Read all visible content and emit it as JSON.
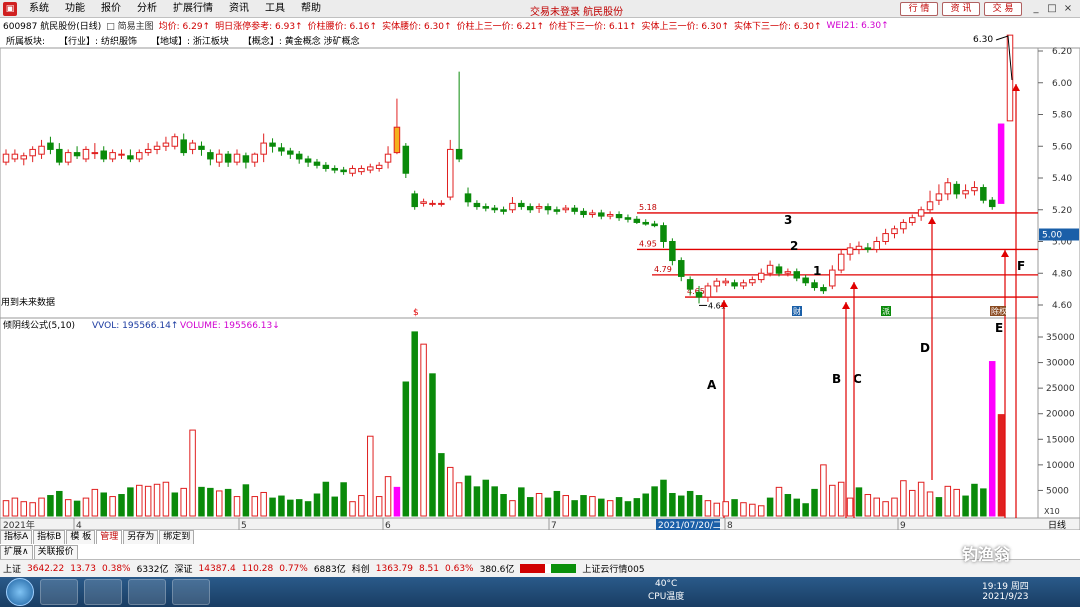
{
  "menu": {
    "items": [
      "系统",
      "功能",
      "报价",
      "分析",
      "扩展行情",
      "资讯",
      "工具",
      "帮助"
    ],
    "center_text": "交易未登录 航民股份",
    "right_buttons": [
      "行 情",
      "资 讯",
      "交 易"
    ],
    "window_controls": [
      "_",
      "□",
      "×"
    ]
  },
  "info": {
    "code_name": "600987 航民股份(日线)",
    "view": "简易主图",
    "items": [
      {
        "t": "均价: 6.29↑",
        "c": "#d00000"
      },
      {
        "t": "明日涨停参考: 6.93↑",
        "c": "#d00000"
      },
      {
        "t": "价柱腰价: 6.16↑",
        "c": "#d00000"
      },
      {
        "t": "实体腰价: 6.30↑",
        "c": "#d00000"
      },
      {
        "t": "价柱上三一价: 6.21↑",
        "c": "#d00000"
      },
      {
        "t": "价柱下三一价: 6.11↑",
        "c": "#d00000"
      },
      {
        "t": "实体上三一价: 6.30↑",
        "c": "#d00000"
      },
      {
        "t": "实体下三一价: 6.30↑",
        "c": "#d00000"
      },
      {
        "t": "WEI21: 6.30↑",
        "c": "#d000d0"
      }
    ]
  },
  "industry": {
    "label": "所属板块:",
    "items": [
      "【行业】: 纺织服饰",
      "【地域】: 浙江板块",
      "【概念】: 黄金概念 涉矿概念"
    ]
  },
  "price_axis": {
    "ticks": [
      6.2,
      6.0,
      5.8,
      5.6,
      5.4,
      5.2,
      5.0,
      4.8,
      4.6
    ],
    "current": "5.00",
    "top_label": "6.30"
  },
  "future_note": "用到未来数据",
  "levels": [
    {
      "v": 5.18,
      "label": "5.18"
    },
    {
      "v": 4.95,
      "label": "4.95"
    },
    {
      "v": 4.79,
      "label": "4.79"
    },
    {
      "v": 4.65,
      "label": "4.65"
    }
  ],
  "low_marker": "4.61",
  "annotations": {
    "numbers": [
      "3",
      "2",
      "1"
    ],
    "letters": [
      "A",
      "B",
      "C",
      "D",
      "E",
      "F"
    ]
  },
  "event_tags": [
    "财",
    "派",
    "除权"
  ],
  "vol": {
    "header": "倾阴线公式(5,10)",
    "vvol": "VVOL: 195566.14↑",
    "volume": "VOLUME: 195566.13↓",
    "ticks": [
      35000,
      30000,
      25000,
      20000,
      15000,
      10000,
      5000
    ],
    "scale": "X10"
  },
  "dates": {
    "year": "2021年",
    "months": [
      "4",
      "5",
      "6",
      "7",
      "8",
      "9"
    ],
    "selected": "2021/07/20/二",
    "right_label": "日线"
  },
  "tabs_row1": [
    "指标A",
    "指标B",
    "模 板",
    "管理",
    "另存为",
    "绑定到"
  ],
  "tabs_row2": [
    "扩展∧",
    "关联报价"
  ],
  "status": {
    "sh_label": "上证",
    "sh": "3642.22",
    "sh_chg": "13.73",
    "sh_pct": "0.38%",
    "sh_amt": "6332亿",
    "sz_label": "深证",
    "sz": "14387.4",
    "sz_chg": "110.28",
    "sz_pct": "0.77%",
    "sz_amt": "6883亿",
    "kc_label": "科创",
    "kc": "1363.79",
    "kc_chg": "8.51",
    "kc_pct": "0.63%",
    "kc_amt": "380.6亿",
    "cloud": "上证云行情005"
  },
  "taskbar": {
    "temp": "40°C",
    "cpu": "CPU温度",
    "time": "19:19 周四",
    "date": "2021/9/23",
    "watermark": "钓渔翁"
  },
  "candles": [
    [
      5.5,
      5.55,
      5.58,
      5.48
    ],
    [
      5.52,
      5.55,
      5.58,
      5.5
    ],
    [
      5.52,
      5.54,
      5.56,
      5.48
    ],
    [
      5.54,
      5.58,
      5.6,
      5.5
    ],
    [
      5.55,
      5.6,
      5.64,
      5.52
    ],
    [
      5.62,
      5.58,
      5.66,
      5.55
    ],
    [
      5.58,
      5.5,
      5.62,
      5.48
    ],
    [
      5.5,
      5.56,
      5.58,
      5.48
    ],
    [
      5.56,
      5.54,
      5.6,
      5.52
    ],
    [
      5.52,
      5.58,
      5.6,
      5.5
    ],
    [
      5.56,
      5.56,
      5.62,
      5.52
    ],
    [
      5.57,
      5.52,
      5.6,
      5.5
    ],
    [
      5.52,
      5.56,
      5.58,
      5.5
    ],
    [
      5.55,
      5.55,
      5.58,
      5.52
    ],
    [
      5.54,
      5.52,
      5.58,
      5.5
    ],
    [
      5.52,
      5.56,
      5.58,
      5.5
    ],
    [
      5.56,
      5.58,
      5.62,
      5.54
    ],
    [
      5.58,
      5.6,
      5.63,
      5.55
    ],
    [
      5.6,
      5.62,
      5.66,
      5.57
    ],
    [
      5.6,
      5.66,
      5.68,
      5.58
    ],
    [
      5.64,
      5.56,
      5.68,
      5.54
    ],
    [
      5.58,
      5.62,
      5.64,
      5.55
    ],
    [
      5.6,
      5.58,
      5.63,
      5.54
    ],
    [
      5.56,
      5.52,
      5.58,
      5.48
    ],
    [
      5.5,
      5.55,
      5.58,
      5.47
    ],
    [
      5.55,
      5.5,
      5.57,
      5.47
    ],
    [
      5.5,
      5.55,
      5.58,
      5.48
    ],
    [
      5.54,
      5.5,
      5.56,
      5.46
    ],
    [
      5.5,
      5.55,
      5.56,
      5.47
    ],
    [
      5.55,
      5.62,
      5.68,
      5.5
    ],
    [
      5.62,
      5.6,
      5.65,
      5.56
    ],
    [
      5.59,
      5.57,
      5.62,
      5.54
    ],
    [
      5.57,
      5.55,
      5.59,
      5.52
    ],
    [
      5.55,
      5.52,
      5.57,
      5.49
    ],
    [
      5.52,
      5.5,
      5.54,
      5.47
    ],
    [
      5.5,
      5.48,
      5.52,
      5.46
    ],
    [
      5.48,
      5.46,
      5.5,
      5.44
    ],
    [
      5.46,
      5.45,
      5.48,
      5.43
    ],
    [
      5.45,
      5.44,
      5.47,
      5.42
    ],
    [
      5.43,
      5.46,
      5.48,
      5.41
    ],
    [
      5.44,
      5.46,
      5.48,
      5.42
    ],
    [
      5.45,
      5.47,
      5.49,
      5.43
    ],
    [
      5.46,
      5.48,
      5.5,
      5.44
    ],
    [
      5.5,
      5.55,
      5.6,
      5.46
    ],
    [
      5.56,
      5.72,
      5.9,
      5.55
    ],
    [
      5.6,
      5.43,
      5.62,
      5.4
    ],
    [
      5.3,
      5.22,
      5.32,
      5.2
    ],
    [
      5.24,
      5.25,
      5.27,
      5.22
    ],
    [
      5.24,
      5.24,
      5.26,
      5.22
    ],
    [
      5.24,
      5.24,
      5.26,
      5.22
    ],
    [
      5.28,
      5.58,
      5.64,
      5.26
    ],
    [
      5.58,
      5.52,
      6.07,
      5.5
    ],
    [
      5.3,
      5.25,
      5.34,
      5.22
    ],
    [
      5.24,
      5.22,
      5.26,
      5.2
    ],
    [
      5.22,
      5.21,
      5.24,
      5.19
    ],
    [
      5.21,
      5.2,
      5.23,
      5.18
    ],
    [
      5.2,
      5.19,
      5.22,
      5.17
    ],
    [
      5.2,
      5.24,
      5.28,
      5.18
    ],
    [
      5.24,
      5.22,
      5.26,
      5.2
    ],
    [
      5.22,
      5.2,
      5.24,
      5.18
    ],
    [
      5.21,
      5.22,
      5.24,
      5.18
    ],
    [
      5.22,
      5.2,
      5.24,
      5.17
    ],
    [
      5.2,
      5.19,
      5.22,
      5.17
    ],
    [
      5.2,
      5.21,
      5.23,
      5.18
    ],
    [
      5.21,
      5.19,
      5.23,
      5.17
    ],
    [
      5.19,
      5.17,
      5.21,
      5.15
    ],
    [
      5.17,
      5.18,
      5.2,
      5.15
    ],
    [
      5.18,
      5.16,
      5.2,
      5.14
    ],
    [
      5.16,
      5.17,
      5.19,
      5.14
    ],
    [
      5.17,
      5.15,
      5.19,
      5.13
    ],
    [
      5.15,
      5.14,
      5.17,
      5.12
    ],
    [
      5.14,
      5.12,
      5.16,
      5.11
    ],
    [
      5.12,
      5.11,
      5.14,
      5.1
    ],
    [
      5.11,
      5.1,
      5.13,
      5.09
    ],
    [
      5.1,
      5.0,
      5.12,
      4.96
    ],
    [
      5.0,
      4.88,
      5.02,
      4.85
    ],
    [
      4.88,
      4.78,
      4.9,
      4.75
    ],
    [
      4.76,
      4.7,
      4.78,
      4.66
    ],
    [
      4.68,
      4.65,
      4.72,
      4.61
    ],
    [
      4.65,
      4.72,
      4.74,
      4.62
    ],
    [
      4.72,
      4.75,
      4.77,
      4.68
    ],
    [
      4.74,
      4.75,
      4.77,
      4.72
    ],
    [
      4.74,
      4.72,
      4.76,
      4.7
    ],
    [
      4.72,
      4.74,
      4.76,
      4.7
    ],
    [
      4.74,
      4.76,
      4.78,
      4.72
    ],
    [
      4.76,
      4.8,
      4.83,
      4.74
    ],
    [
      4.8,
      4.85,
      4.88,
      4.78
    ],
    [
      4.84,
      4.8,
      4.86,
      4.78
    ],
    [
      4.8,
      4.81,
      4.83,
      4.78
    ],
    [
      4.81,
      4.77,
      4.83,
      4.75
    ],
    [
      4.77,
      4.74,
      4.79,
      4.72
    ],
    [
      4.74,
      4.71,
      4.76,
      4.69
    ],
    [
      4.71,
      4.69,
      4.73,
      4.67
    ],
    [
      4.72,
      4.82,
      4.85,
      4.7
    ],
    [
      4.82,
      4.92,
      4.95,
      4.8
    ],
    [
      4.92,
      4.96,
      4.99,
      4.88
    ],
    [
      4.95,
      4.97,
      5.0,
      4.92
    ],
    [
      4.96,
      4.95,
      4.99,
      4.93
    ],
    [
      4.95,
      5.0,
      5.03,
      4.93
    ],
    [
      5.0,
      5.05,
      5.08,
      4.98
    ],
    [
      5.05,
      5.08,
      5.1,
      5.02
    ],
    [
      5.08,
      5.12,
      5.14,
      5.05
    ],
    [
      5.12,
      5.15,
      5.17,
      5.1
    ],
    [
      5.16,
      5.2,
      5.22,
      5.13
    ],
    [
      5.2,
      5.25,
      5.32,
      5.18
    ],
    [
      5.26,
      5.3,
      5.36,
      5.23
    ],
    [
      5.3,
      5.37,
      5.4,
      5.26
    ],
    [
      5.36,
      5.3,
      5.38,
      5.27
    ],
    [
      5.3,
      5.32,
      5.36,
      5.27
    ],
    [
      5.32,
      5.34,
      5.38,
      5.29
    ],
    [
      5.34,
      5.26,
      5.36,
      5.24
    ],
    [
      5.26,
      5.22,
      5.28,
      5.2
    ],
    [
      5.24,
      5.74,
      5.74,
      5.24
    ],
    [
      5.76,
      6.3,
      6.3,
      5.76
    ]
  ],
  "volumes": [
    3000,
    3500,
    2800,
    2600,
    3500,
    4000,
    4800,
    3200,
    2900,
    3500,
    5200,
    4500,
    3800,
    4200,
    5500,
    6000,
    5800,
    6200,
    6600,
    4500,
    5400,
    16800,
    5600,
    5400,
    4900,
    5200,
    3800,
    6100,
    3800,
    4600,
    3500,
    3900,
    3100,
    3200,
    2800,
    4300,
    6600,
    3700,
    6500,
    2800,
    4000,
    15600,
    3800,
    7700,
    5600,
    26200,
    36000,
    33600,
    27800,
    12200,
    9500,
    6500,
    7800,
    5700,
    7000,
    5700,
    4200,
    3000,
    5500,
    3600,
    4400,
    3500,
    4800,
    4000,
    3000,
    4000,
    3800,
    3300,
    3000,
    3600,
    2800,
    3400,
    4300,
    5700,
    7000,
    4400,
    3900,
    4800,
    4000,
    3000,
    2500,
    2800,
    3200,
    2600,
    2300,
    2000,
    3500,
    5600,
    4200,
    3300,
    2400,
    5200,
    10000,
    6000,
    6600,
    3500,
    5500,
    4200,
    3500,
    2800,
    3500,
    6900,
    5000,
    6600,
    4700,
    3600,
    5800,
    5200,
    3900,
    6200,
    5300,
    30200,
    19800
  ],
  "vol_color": [
    "u",
    "u",
    "u",
    "u",
    "u",
    "d",
    "d",
    "u",
    "d",
    "u",
    "u",
    "d",
    "u",
    "d",
    "d",
    "u",
    "u",
    "u",
    "u",
    "d",
    "u",
    "u",
    "d",
    "d",
    "u",
    "d",
    "u",
    "d",
    "u",
    "u",
    "d",
    "d",
    "d",
    "d",
    "d",
    "d",
    "d",
    "d",
    "d",
    "u",
    "u",
    "u",
    "u",
    "u",
    "p",
    "d",
    "d",
    "u",
    "d",
    "d",
    "u",
    "u",
    "d",
    "d",
    "d",
    "d",
    "d",
    "u",
    "d",
    "d",
    "u",
    "d",
    "d",
    "u",
    "d",
    "d",
    "u",
    "d",
    "u",
    "d",
    "d",
    "d",
    "d",
    "d",
    "d",
    "d",
    "d",
    "d",
    "d",
    "u",
    "u",
    "u",
    "d",
    "u",
    "u",
    "u",
    "d",
    "u",
    "d",
    "d",
    "d",
    "d",
    "u",
    "u",
    "u",
    "u",
    "d",
    "u",
    "u",
    "u",
    "u",
    "u",
    "u",
    "u",
    "u",
    "d",
    "u",
    "u",
    "d",
    "d",
    "d",
    "p",
    "u"
  ]
}
